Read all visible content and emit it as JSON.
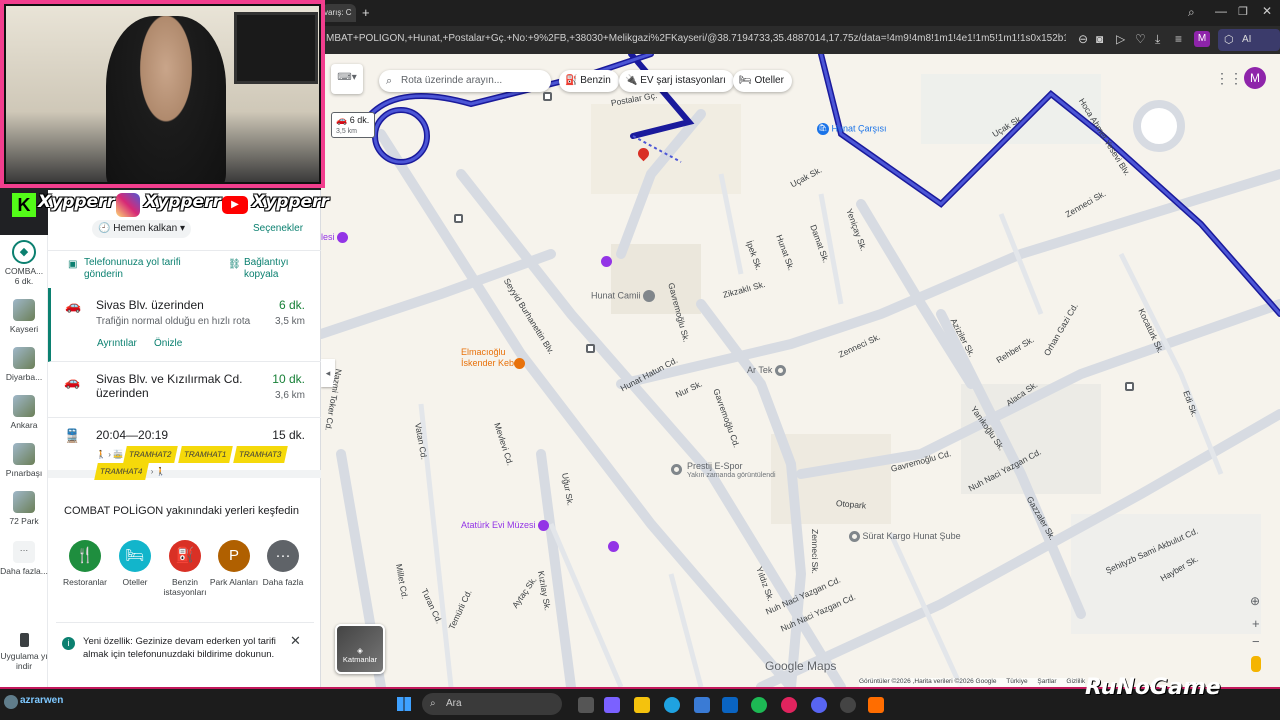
{
  "browser": {
    "tab_title": "varış: C",
    "url": "MBAT+POLİGON,+Hunat,+Postalar+Gç.+No:+9%2FB,+38030+Melikgazi%2FKayseri/@38.7194733,35.4887014,17.75z/data=!4m9!4m8!1m1!4e1!1m5!1m1!1s0x152b132d2f85ba33:0xff656dab79c6",
    "profile_initial": "M",
    "ai_label": "AI"
  },
  "social": {
    "k_handle": "Xypperr",
    "ig_handle": "Xypperr",
    "yt_handle": "Xypperr"
  },
  "rail": {
    "items": [
      {
        "label": "COMBA...",
        "sub": "6 dk."
      },
      {
        "label": "Kayseri"
      },
      {
        "label": "Diyarba..."
      },
      {
        "label": "Ankara"
      },
      {
        "label": "Pınarbaşı"
      },
      {
        "label": "72 Park"
      },
      {
        "label": "Daha fazla..."
      }
    ],
    "app_label": "Uygulama yı indir"
  },
  "panel": {
    "leave_now": "Hemen kalkan",
    "options": "Seçenekler",
    "send_phone": "Telefonunuza yol tarifi gönderin",
    "copy_link": "Bağlantıyı kopyala",
    "routes": [
      {
        "title": "Sivas Blv. üzerinden",
        "time": "6 dk.",
        "sub": "Trafiğin normal olduğu en hızlı rota",
        "dist": "3,5 km",
        "details": "Ayrıntılar",
        "preview": "Önizle"
      },
      {
        "title": "Sivas Blv. ve Kızılırmak Cd. üzerinden",
        "time": "10 dk.",
        "dist": "3,6 km"
      },
      {
        "title": "20:04—20:19",
        "time": "15 dk.",
        "trams": [
          "TRAMHAT2",
          "TRAMHAT1",
          "TRAMHAT3",
          "TRAMHAT4"
        ]
      }
    ],
    "explore_title": "COMBAT POLİGON yakınındaki yerleri keşfedin",
    "categories": [
      {
        "label": "Restoranlar",
        "color": "#1e8e3e",
        "glyph": "🍴"
      },
      {
        "label": "Oteller",
        "color": "#12b5cb",
        "glyph": "🛏"
      },
      {
        "label": "Benzin istasyonları",
        "color": "#d93025",
        "glyph": "⛽"
      },
      {
        "label": "Park Alanları",
        "color": "#b06000",
        "glyph": "P"
      },
      {
        "label": "Daha fazla",
        "color": "#5f6368",
        "glyph": "···"
      }
    ],
    "notice": "Yeni özellik: Gezinize devam ederken yol tarifi almak için telefonunuzdaki bildirime dokunun."
  },
  "map": {
    "search_placeholder": "Rota üzerinde arayın...",
    "chips": [
      "Benzin",
      "EV şarj istasyonları",
      "Oteller"
    ],
    "car_time": "6 dk.",
    "car_dist": "3,5 km",
    "layers": "Katmanlar",
    "logo": "Google Maps",
    "footer": [
      "Görüntüler ©2026 ,Harita verileri ©2026 Google",
      "Türkiye",
      "Şartlar",
      "Gizlilik"
    ],
    "pois": [
      {
        "name": "Hunat Çarşısı",
        "color": "#1a73e8"
      },
      {
        "name": "Hunat Camii",
        "color": "#5f6368"
      },
      {
        "name": "Elmacıoğlu İskender Kebap",
        "color": "#e8710a"
      },
      {
        "name": "Ar Tek",
        "color": "#5f6368"
      },
      {
        "name": "Prestij E-Spor",
        "color": "#5f6368"
      },
      {
        "name": "Yakın zamanda görüntülendi",
        "color": "#70757a"
      },
      {
        "name": "Atatürk Evi Müzesi",
        "color": "#9334e6"
      },
      {
        "name": "Sürat Kargo Hunat Şube",
        "color": "#5f6368"
      },
      {
        "name": "lesi",
        "color": "#9334e6"
      }
    ],
    "streets": [
      "Uçak Sk.",
      "Uçak Sk.",
      "İpek Sk.",
      "Hunat Sk.",
      "Damat Sk.",
      "Yeniçay Sk.",
      "Zikzaklı Sk.",
      "Gavremoğlu Sk.",
      "Zenneci Sk.",
      "Zenneci Sk.",
      "Seyyid Burhanettin Blv.",
      "Nazmi Toker Cd.",
      "Hunat Hatun Cd.",
      "Nur Sk.",
      "Gavremoğlu Cd.",
      "Gavremoğlu Cd.",
      "Aziziler Sk.",
      "Rehber Sk.",
      "Orhan Gazi Cd.",
      "Alaca Sk.",
      "Yanıkoğlu Sk.",
      "Nuh Naci Yazgan Cd.",
      "Nuh Naci Yazgan Cd.",
      "Nuh Naci Yazgan Cd.",
      "Şehityzb Sami Akbulut Cd.",
      "Gazzaler Sk.",
      "Mevlevi Cd.",
      "Vatan Cd.",
      "Uğur Sk.",
      "Kızılay Sk.",
      "Millet Cd.",
      "Temürli Cd.",
      "Turan Cd.",
      "Aytaç Sk.",
      "Otopark",
      "Yıldız Sk.",
      "Zenneci Sk.",
      "Kocatürk Sk.",
      "Edi Sk.",
      "Hayber Sk.",
      "Hoca Ahmet Yesevi Blv.",
      "Postalar Gç."
    ]
  },
  "taskbar": {
    "user": "azrarwen",
    "search": "Ara",
    "brand": "RuNoGame"
  }
}
